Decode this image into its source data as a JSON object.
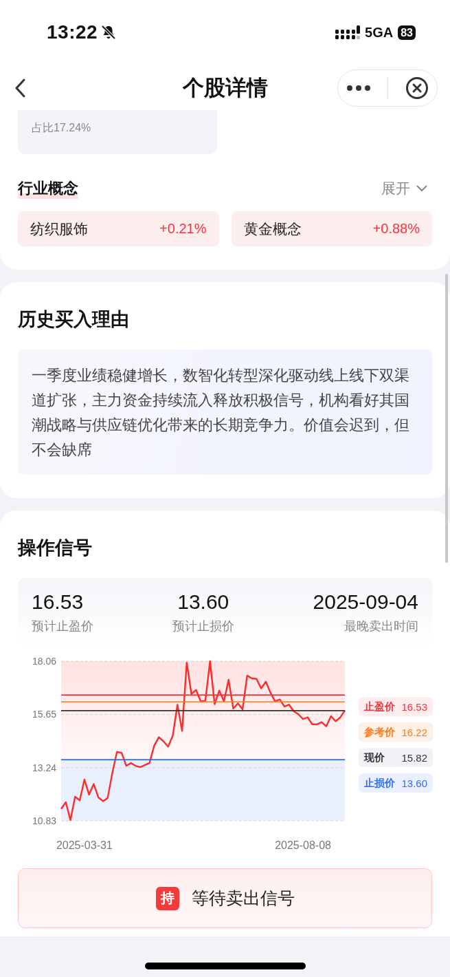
{
  "status_bar": {
    "time": "13:22",
    "network": "5GA",
    "battery": "83"
  },
  "header": {
    "title": "个股详情"
  },
  "summary": {
    "text": "占比17.24%"
  },
  "concepts": {
    "title": "行业概念",
    "expand": "展开",
    "items": [
      {
        "name": "纺织服饰",
        "change": "+0.21%"
      },
      {
        "name": "黄金概念",
        "change": "+0.88%"
      }
    ]
  },
  "reason": {
    "title": "历史买入理由",
    "text": "一季度业绩稳健增长，数智化转型深化驱动线上线下双渠道扩张，主力资金持续流入释放积极信号，机构看好其国潮战略与供应链优化带来的长期竞争力。价值会迟到，但不会缺席"
  },
  "signal": {
    "title": "操作信号",
    "stats": [
      {
        "value": "16.53",
        "label": "预计止盈价"
      },
      {
        "value": "13.60",
        "label": "预计止损价"
      },
      {
        "value": "2025-09-04",
        "label": "最晚卖出时间"
      }
    ],
    "legend_values": [
      "16.53",
      "16.22",
      "15.82",
      "13.60"
    ],
    "chart_data": {
      "type": "line",
      "categories": [
        null,
        null,
        null,
        null,
        null,
        "2025-03-31",
        null,
        null,
        null,
        null,
        null,
        null,
        null,
        null,
        null,
        null,
        null,
        null,
        null,
        null,
        null,
        null,
        null,
        null,
        null,
        null,
        null,
        null,
        null,
        null,
        null,
        null,
        null,
        null,
        null,
        null,
        null,
        null,
        null,
        null,
        null,
        null,
        null,
        null,
        null,
        null,
        null,
        null,
        null,
        null,
        null,
        null,
        "2025-08-08",
        null,
        null,
        null,
        null,
        null,
        null,
        null,
        null,
        null
      ],
      "series": [
        {
          "color": "#ff2b2b",
          "values": [
            11.37,
            11.67,
            10.86,
            11.92,
            11.76,
            12.7,
            12.02,
            12.5,
            11.89,
            11.72,
            11.86,
            13.0,
            13.95,
            13.91,
            13.32,
            13.45,
            13.32,
            13.26,
            13.36,
            13.45,
            14.23,
            14.62,
            14.43,
            14.19,
            14.69,
            16.09,
            14.9,
            17.99,
            16.57,
            16.76,
            16.24,
            16.27,
            18.06,
            16.11,
            16.73,
            16.24,
            17.22,
            15.92,
            16.15,
            15.88,
            17.41,
            17.28,
            17.26,
            16.83,
            17.13,
            16.63,
            16.24,
            16.33,
            16.01,
            16.09,
            15.79,
            15.66,
            15.44,
            15.52,
            15.2,
            15.2,
            15.3,
            15.11,
            15.57,
            15.34,
            15.51,
            15.83
          ]
        },
        {
          "name": "止盈价",
          "color": "#f5333f",
          "values": [
            16.53,
            16.53,
            16.53,
            16.53,
            16.53,
            16.53,
            16.53,
            16.53,
            16.53,
            16.53,
            16.53,
            16.53,
            16.53,
            16.53,
            16.53,
            16.53,
            16.53,
            16.53,
            16.53,
            16.53,
            16.53,
            16.53,
            16.53,
            16.53,
            16.53,
            16.53,
            16.53,
            16.53,
            16.53,
            16.53,
            16.53,
            16.53,
            16.53,
            16.53,
            16.53,
            16.53,
            16.53,
            16.53,
            16.53,
            16.53,
            16.53,
            16.53,
            16.53,
            16.53,
            16.53,
            16.53,
            16.53,
            16.53,
            16.53,
            16.53,
            16.53,
            16.53,
            16.53,
            16.53,
            16.53,
            16.53,
            16.53,
            16.53,
            16.53,
            16.53,
            16.53,
            16.53
          ]
        },
        {
          "name": "参考价",
          "color": "#ff7a1a",
          "values": [
            16.22,
            16.22,
            16.22,
            16.22,
            16.22,
            16.22,
            16.22,
            16.22,
            16.22,
            16.22,
            16.22,
            16.22,
            16.22,
            16.22,
            16.22,
            16.22,
            16.22,
            16.22,
            16.22,
            16.22,
            16.22,
            16.22,
            16.22,
            16.22,
            16.22,
            16.22,
            16.22,
            16.22,
            16.22,
            16.22,
            16.22,
            16.22,
            16.22,
            16.22,
            16.22,
            16.22,
            16.22,
            16.22,
            16.22,
            16.22,
            16.22,
            16.22,
            16.22,
            16.22,
            16.22,
            16.22,
            16.22,
            16.22,
            16.22,
            16.22,
            16.22,
            16.22,
            16.22,
            16.22,
            16.22,
            16.22,
            16.22,
            16.22,
            16.22,
            16.22,
            16.22,
            16.22
          ]
        },
        {
          "name": "现价",
          "color": "#333333",
          "values": [
            15.82,
            15.82,
            15.82,
            15.82,
            15.82,
            15.82,
            15.82,
            15.82,
            15.82,
            15.82,
            15.82,
            15.82,
            15.82,
            15.82,
            15.82,
            15.82,
            15.82,
            15.82,
            15.82,
            15.82,
            15.82,
            15.82,
            15.82,
            15.82,
            15.82,
            15.82,
            15.82,
            15.82,
            15.82,
            15.82,
            15.82,
            15.82,
            15.82,
            15.82,
            15.82,
            15.82,
            15.82,
            15.82,
            15.82,
            15.82,
            15.82,
            15.82,
            15.82,
            15.82,
            15.82,
            15.82,
            15.82,
            15.82,
            15.82,
            15.82,
            15.82,
            15.82,
            15.82,
            15.82,
            15.82,
            15.82,
            15.82,
            15.82,
            15.82,
            15.82,
            15.82,
            15.82
          ]
        },
        {
          "name": "止损价",
          "color": "#2f6bff",
          "values": [
            13.6,
            13.6,
            13.6,
            13.6,
            13.6,
            13.6,
            13.6,
            13.6,
            13.6,
            13.6,
            13.6,
            13.6,
            13.6,
            13.6,
            13.6,
            13.6,
            13.6,
            13.6,
            13.6,
            13.6,
            13.6,
            13.6,
            13.6,
            13.6,
            13.6,
            13.6,
            13.6,
            13.6,
            13.6,
            13.6,
            13.6,
            13.6,
            13.6,
            13.6,
            13.6,
            13.6,
            13.6,
            13.6,
            13.6,
            13.6,
            13.6,
            13.6,
            13.6,
            13.6,
            13.6,
            13.6,
            13.6,
            13.6,
            13.6,
            13.6,
            13.6,
            13.6,
            13.6,
            13.6,
            13.6,
            13.6,
            13.6,
            13.6,
            13.6,
            13.6,
            13.6,
            13.6
          ]
        }
      ],
      "ylim": [
        10.83,
        18.06
      ],
      "yticks": [
        18.06,
        15.65,
        13.24,
        10.83
      ]
    },
    "action": {
      "badge": "持",
      "text": "等待卖出信号"
    }
  }
}
